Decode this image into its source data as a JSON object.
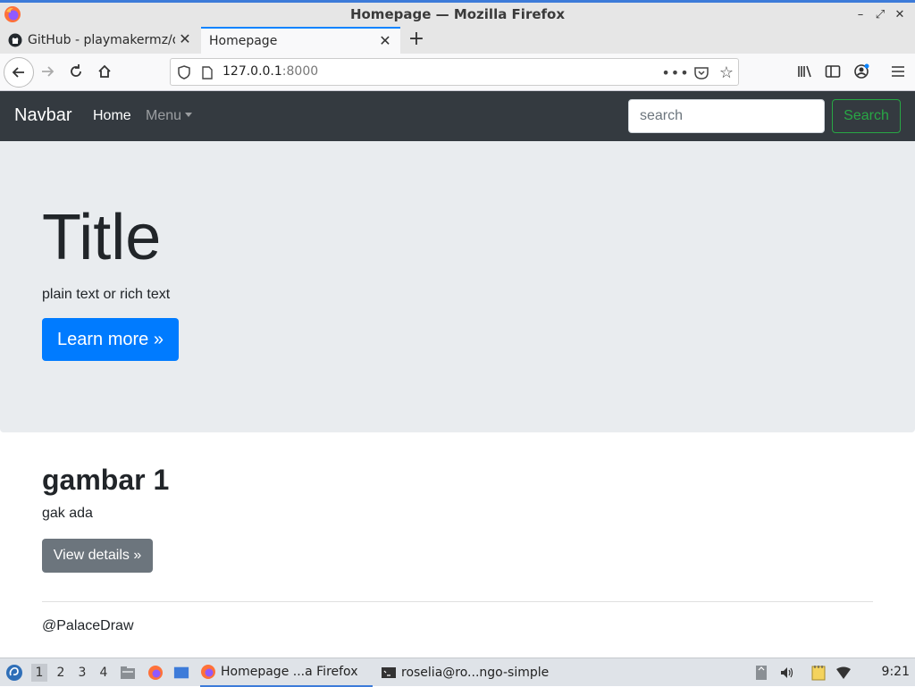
{
  "window": {
    "title": "Homepage — Mozilla Firefox"
  },
  "tabs": [
    {
      "label": "GitHub - playmakermz/d",
      "icon": "github-icon",
      "active": false
    },
    {
      "label": "Homepage",
      "icon": "none",
      "active": true
    }
  ],
  "toolbar": {
    "url_host": "127.0.0.1",
    "url_port": ":8000"
  },
  "site": {
    "brand": "Navbar",
    "nav_home": "Home",
    "nav_menu": "Menu",
    "search_placeholder": "search",
    "search_button": "Search",
    "jumbo_title": "Title",
    "jumbo_text": "plain text or rich text",
    "learn_more": "Learn more »",
    "card_title": "gambar 1",
    "card_text": "gak ada",
    "view_details": "View details »",
    "footer": "@PalaceDraw"
  },
  "taskbar": {
    "workspaces": [
      "1",
      "2",
      "3",
      "4"
    ],
    "active_workspace": "1",
    "apps": [
      {
        "label": "Homepage ...a Firefox",
        "icon": "firefox-icon",
        "active": true
      },
      {
        "label": "roselia@ro...ngo-simple",
        "icon": "terminal-icon",
        "active": false
      }
    ],
    "clock": "9:21"
  },
  "colors": {
    "navbar_bg": "#343a40",
    "jumbotron_bg": "#e9ecef",
    "primary": "#007bff",
    "secondary": "#6c757d",
    "success": "#28a745"
  }
}
